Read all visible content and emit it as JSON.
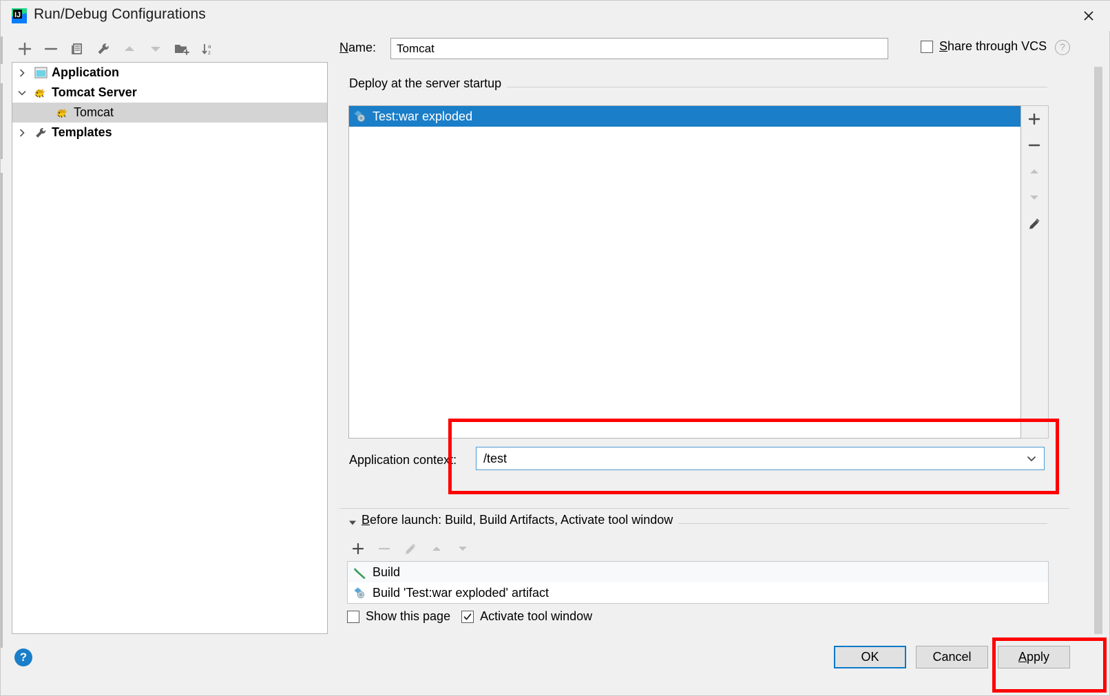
{
  "window": {
    "title": "Run/Debug Configurations",
    "app_icon": "intellij-idea-icon",
    "close_icon": "close-icon"
  },
  "left_toolbar": {
    "buttons": [
      {
        "name": "add-configuration-button",
        "icon": "plus-icon",
        "tooltip": "Add New Configuration",
        "enabled": true
      },
      {
        "name": "remove-configuration-button",
        "icon": "minus-icon",
        "tooltip": "Remove Configuration",
        "enabled": true
      },
      {
        "name": "copy-configuration-button",
        "icon": "copy-icon",
        "tooltip": "Copy Configuration",
        "enabled": true
      },
      {
        "name": "edit-templates-button",
        "icon": "wrench-icon",
        "tooltip": "Edit Templates",
        "enabled": true
      },
      {
        "name": "move-up-button",
        "icon": "arrow-up-icon",
        "tooltip": "Move Up",
        "enabled": false
      },
      {
        "name": "move-down-button",
        "icon": "arrow-down-icon",
        "tooltip": "Move Down",
        "enabled": false
      },
      {
        "name": "move-into-folder-button",
        "icon": "folder-add-icon",
        "tooltip": "Create New Folder",
        "enabled": true
      },
      {
        "name": "sort-button",
        "icon": "sort-az-icon",
        "tooltip": "Sort Configurations",
        "enabled": true
      }
    ]
  },
  "tree": {
    "items": [
      {
        "label": "Application",
        "icon": "application-icon",
        "arrow": "chevron-right",
        "level": 0,
        "selected": false
      },
      {
        "label": "Tomcat Server",
        "icon": "tomcat-icon",
        "arrow": "chevron-down",
        "level": 0,
        "selected": false
      },
      {
        "label": "Tomcat",
        "icon": "tomcat-icon",
        "arrow": "none",
        "level": 1,
        "selected": true
      },
      {
        "label": "Templates",
        "icon": "wrench-icon",
        "arrow": "chevron-right",
        "level": 0,
        "selected": false
      }
    ]
  },
  "header": {
    "name_label": "Name:",
    "name_label_mnemonic": "N",
    "name_label_rest": "ame:",
    "name_value": "Tomcat",
    "name_placeholder": "",
    "share_label": "Share through VCS",
    "share_mnemonic": "S",
    "share_label_rest": "hare through VCS",
    "share_checked": false,
    "help_icon": "question-mark-icon"
  },
  "deploy": {
    "group_title": "Deploy at the server startup",
    "rows": [
      {
        "label": "Test:war exploded",
        "icon": "artifact-icon",
        "selected": true
      }
    ],
    "side_buttons": [
      {
        "name": "deploy-add-button",
        "icon": "plus-icon",
        "enabled": true
      },
      {
        "name": "deploy-remove-button",
        "icon": "minus-icon",
        "enabled": true
      },
      {
        "name": "deploy-move-up-button",
        "icon": "arrow-up-icon",
        "enabled": false
      },
      {
        "name": "deploy-move-down-button",
        "icon": "arrow-down-icon",
        "enabled": false
      },
      {
        "name": "deploy-edit-button",
        "icon": "pencil-icon",
        "enabled": true
      }
    ]
  },
  "application_context": {
    "label": "Application context:",
    "value": "/test",
    "dropdown_icon": "chevron-down-icon",
    "options": [
      "/test"
    ]
  },
  "before_launch": {
    "title": "Before launch: Build, Build Artifacts, Activate tool window",
    "title_mnemonic": "B",
    "title_rest": "efore launch: Build, Build Artifacts, Activate tool window",
    "collapse_icon": "triangle-down-icon",
    "toolbar": [
      {
        "name": "before-launch-add-button",
        "icon": "plus-icon",
        "enabled": true
      },
      {
        "name": "before-launch-remove-button",
        "icon": "minus-icon",
        "enabled": false
      },
      {
        "name": "before-launch-edit-button",
        "icon": "pencil-icon",
        "enabled": false
      },
      {
        "name": "before-launch-move-up-button",
        "icon": "arrow-up-icon",
        "enabled": false
      },
      {
        "name": "before-launch-move-down-button",
        "icon": "arrow-down-icon",
        "enabled": false
      }
    ],
    "tasks": [
      {
        "label": "Build",
        "icon": "hammer-icon"
      },
      {
        "label": "Build 'Test:war exploded' artifact",
        "icon": "artifact-icon"
      }
    ],
    "show_page_label": "Show this page",
    "show_page_checked": false,
    "activate_tool_window_label": "Activate tool window",
    "activate_tool_window_checked": true
  },
  "footer": {
    "help_label": "?",
    "ok_label": "OK",
    "cancel_label": "Cancel",
    "apply_label": "Apply",
    "apply_mnemonic": "A",
    "apply_rest": "pply"
  },
  "colors": {
    "selection_blue": "#1a7ec8",
    "highlight_red": "#ff0000",
    "tree_selection_gray": "#d4d4d4",
    "dialog_bg": "#f0f0f0",
    "focus_border": "#4a9ad4"
  }
}
